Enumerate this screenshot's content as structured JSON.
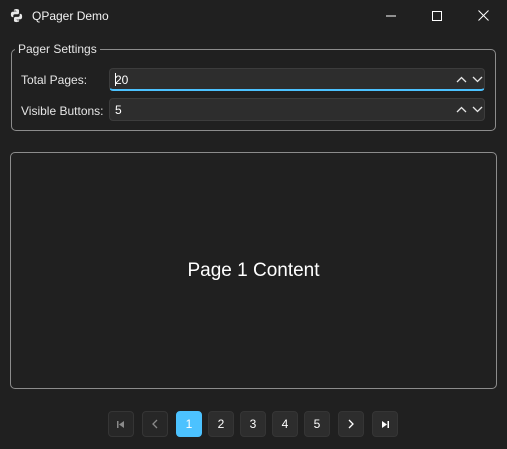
{
  "window": {
    "title": "QPager Demo"
  },
  "settings": {
    "group_title": "Pager Settings",
    "total_pages": {
      "label": "Total Pages:",
      "value": "20"
    },
    "visible_buttons": {
      "label": "Visible Buttons:",
      "value": "5"
    }
  },
  "content": {
    "text": "Page 1 Content"
  },
  "pager": {
    "pages": [
      "1",
      "2",
      "3",
      "4",
      "5"
    ],
    "current_page": "1"
  },
  "colors": {
    "accent": "#4cc2ff",
    "background": "#202020",
    "control": "#2d2d2d"
  },
  "icons": {
    "app": "python-logo-icon",
    "first": "first-page-icon",
    "prev": "chevron-left-icon",
    "next": "chevron-right-icon",
    "last": "last-page-icon"
  }
}
